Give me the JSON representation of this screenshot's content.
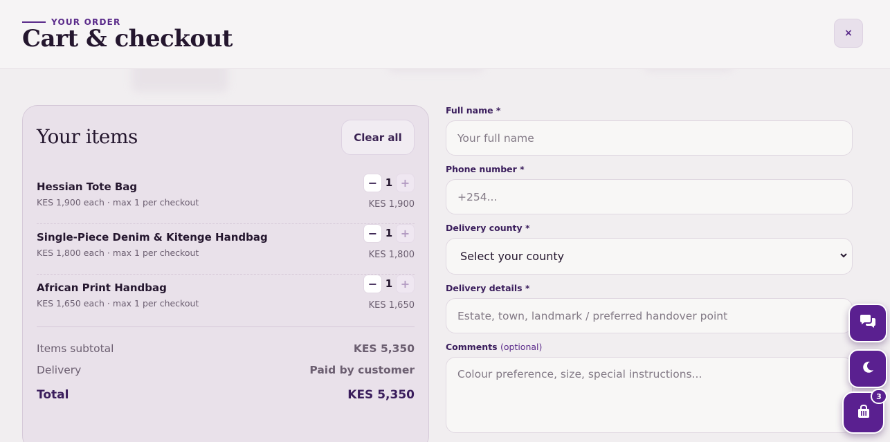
{
  "header": {
    "eyebrow": "YOUR ORDER",
    "title": "Cart & checkout",
    "close_label": "×"
  },
  "cart": {
    "title": "Your items",
    "clear_label": "Clear all",
    "items": [
      {
        "name": "Hessian Tote Bag",
        "meta": "KES 1,900 each · max 1 per checkout",
        "qty": "1",
        "total": "KES 1,900"
      },
      {
        "name": "Single-Piece Denim & Kitenge Handbag",
        "meta": "KES 1,800 each · max 1 per checkout",
        "qty": "1",
        "total": "KES 1,800"
      },
      {
        "name": "African Print Handbag",
        "meta": "KES 1,650 each · max 1 per checkout",
        "qty": "1",
        "total": "KES 1,650"
      }
    ],
    "minus_label": "−",
    "plus_label": "+",
    "subtotal_label": "Items subtotal",
    "subtotal_value": "KES 5,350",
    "delivery_label": "Delivery",
    "delivery_value": "Paid by customer",
    "total_label": "Total",
    "total_value": "KES 5,350"
  },
  "form": {
    "full_name_label": "Full name *",
    "full_name_placeholder": "Your full name",
    "phone_label": "Phone number *",
    "phone_placeholder": "+254...",
    "county_label": "Delivery county *",
    "county_selected": "Select your county",
    "details_label": "Delivery details *",
    "details_placeholder": "Estate, town, landmark / preferred handover point",
    "comments_label": "Comments",
    "comments_optional": "(optional)",
    "comments_placeholder": "Colour preference, size, special instructions..."
  },
  "fabs": {
    "cart_count": "3"
  },
  "colors": {
    "accent": "#5a2090",
    "card_bg": "#e9e1ea",
    "page_bg": "#f1eef0"
  },
  "icons": [
    "close-icon",
    "chat-icon",
    "moon-icon",
    "shopping-bag-icon",
    "chevron-down-icon"
  ]
}
